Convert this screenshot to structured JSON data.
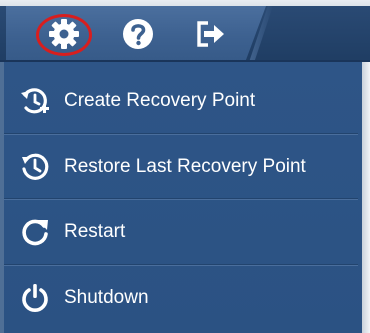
{
  "toolbar": {
    "icons": [
      "gear-icon",
      "help-icon",
      "logout-icon"
    ],
    "highlight_color": "#d81e1e",
    "accent": "#2b5283"
  },
  "menu": {
    "items": [
      {
        "label": "Create Recovery Point",
        "icon": "create-recovery-point-icon"
      },
      {
        "label": "Restore Last Recovery Point",
        "icon": "restore-icon"
      },
      {
        "label": "Restart",
        "icon": "restart-icon"
      },
      {
        "label": "Shutdown",
        "icon": "power-icon"
      }
    ]
  }
}
